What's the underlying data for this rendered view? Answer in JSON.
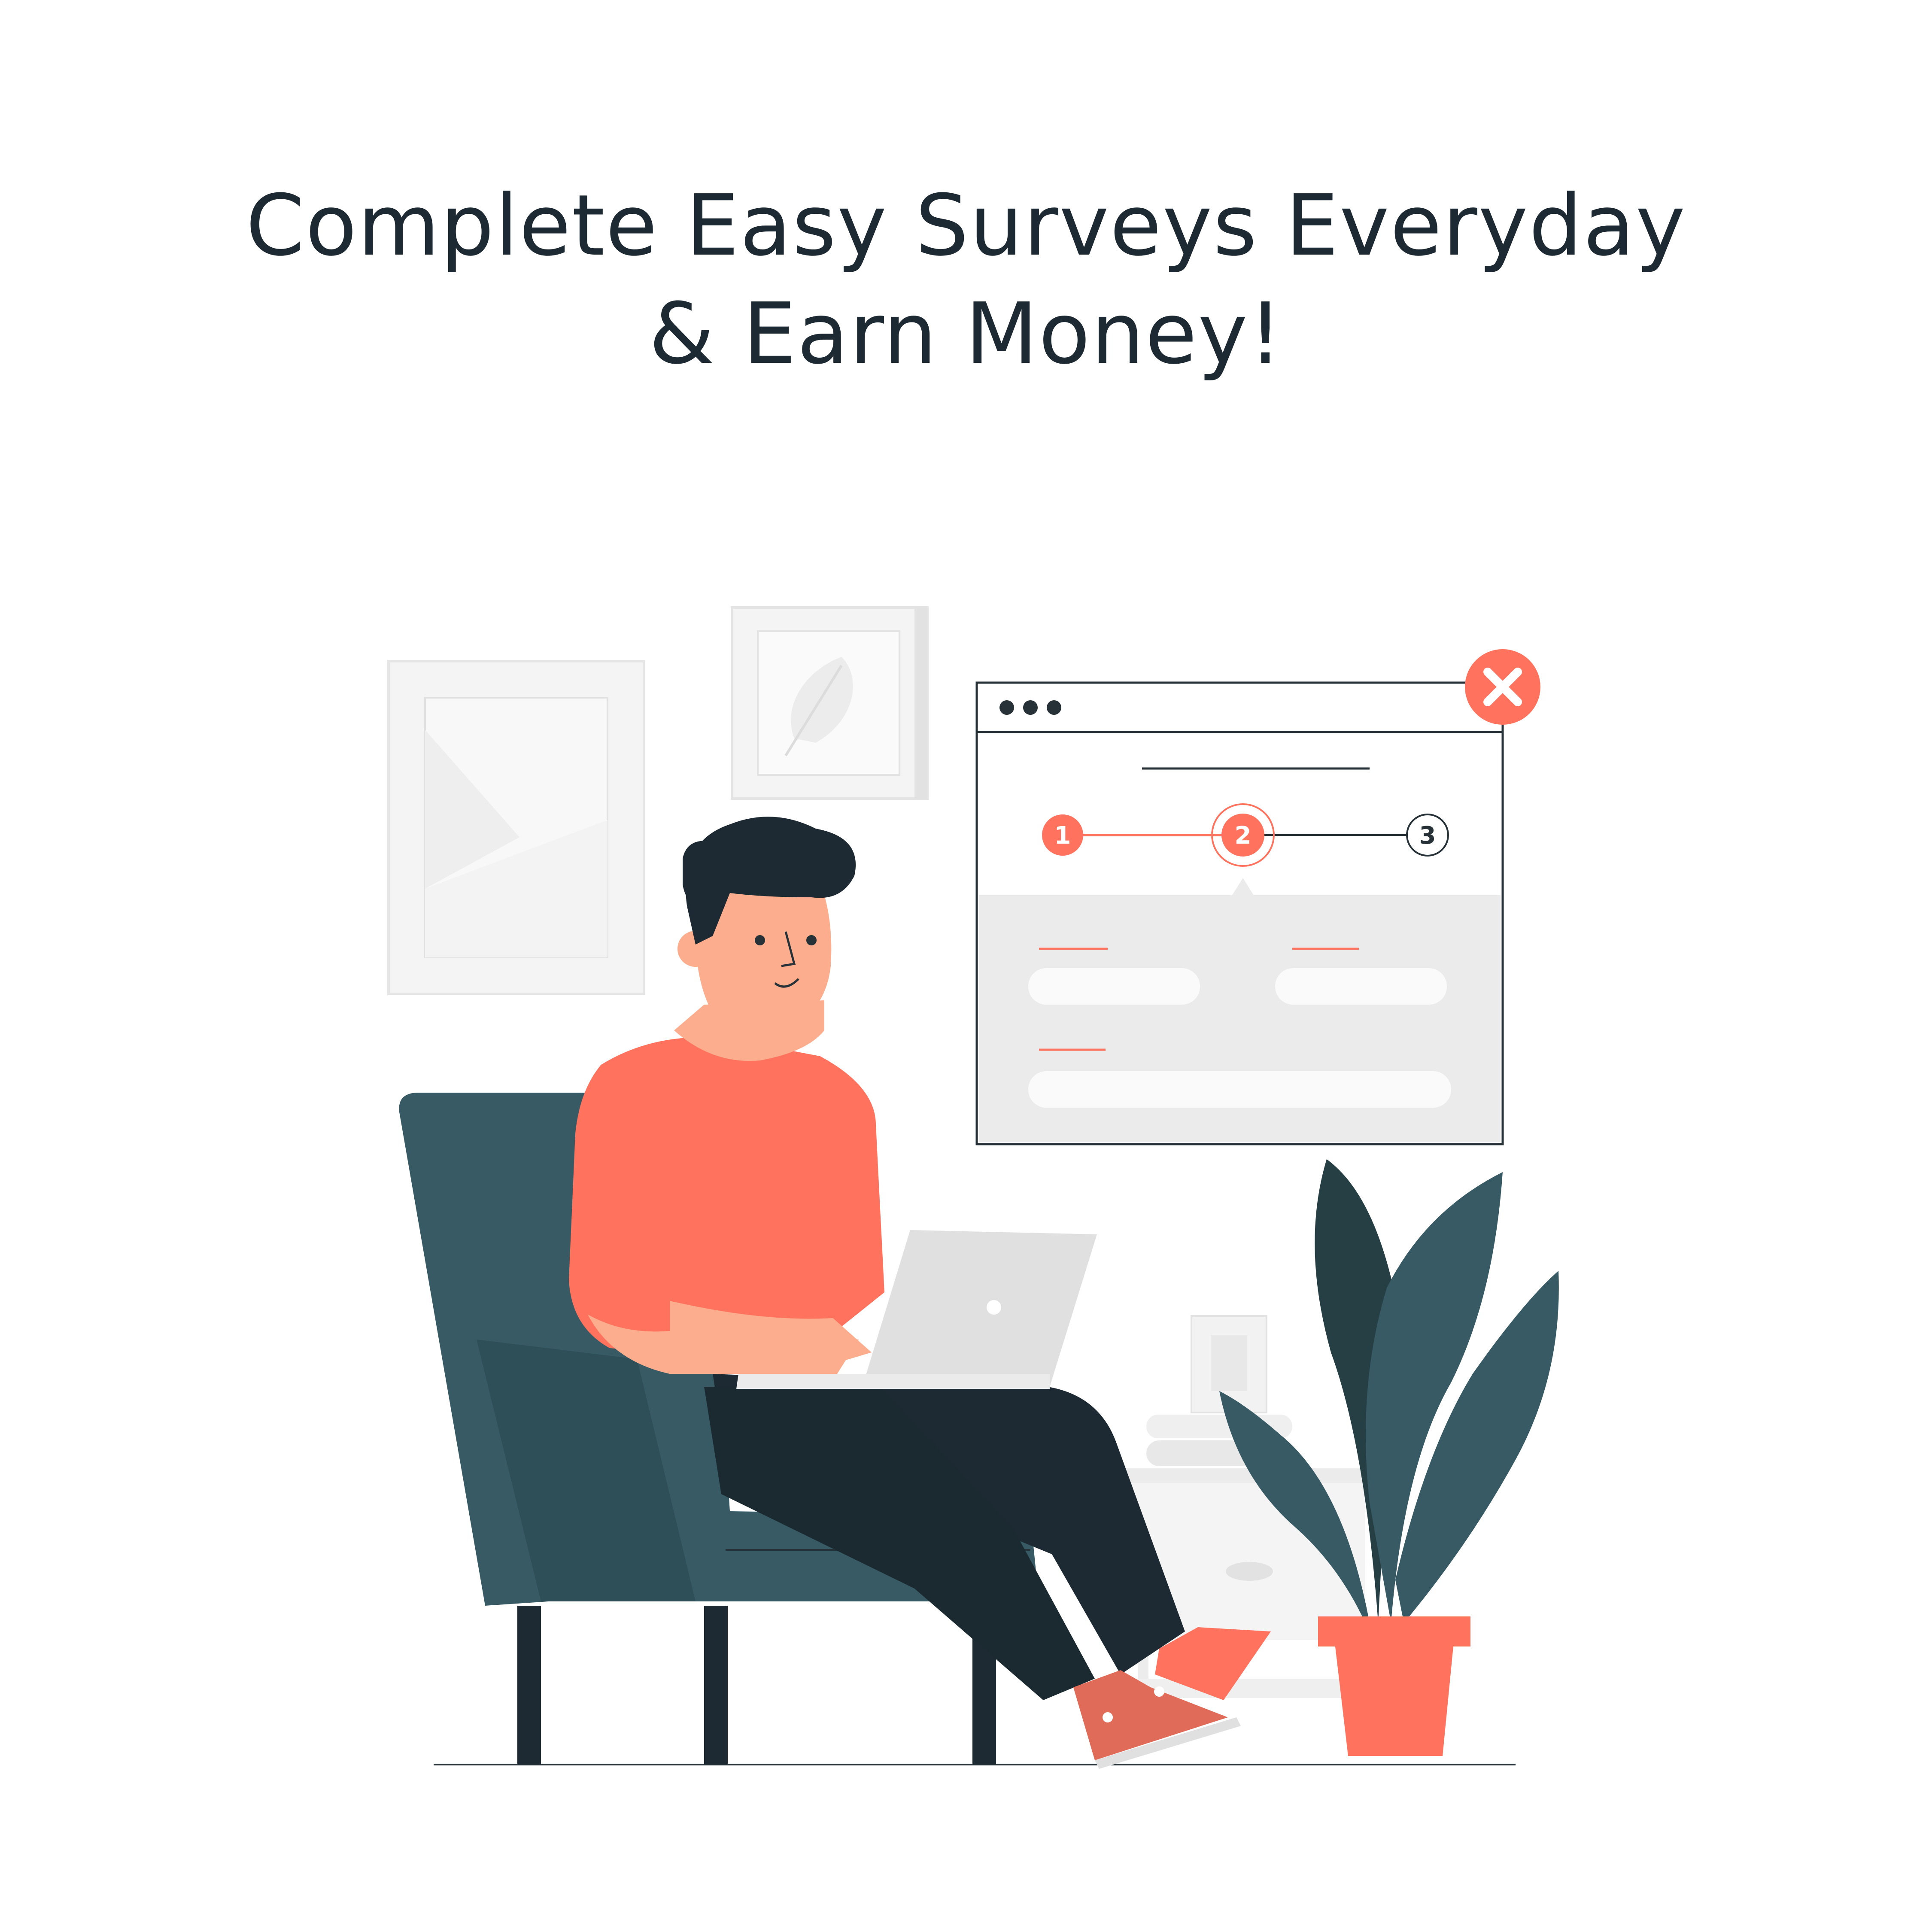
{
  "headline": {
    "line1": "Complete Easy Surveys Everyday",
    "line2": "& Earn Money!"
  },
  "survey_window": {
    "steps": [
      "1",
      "2",
      "3"
    ],
    "active_step": 2,
    "close_icon": "close-icon"
  },
  "colors": {
    "accent": "#ff725e",
    "dark": "#1e2a33",
    "chair": "#375a64",
    "plant_dark": "#263f44",
    "panel": "#ebebeb"
  }
}
